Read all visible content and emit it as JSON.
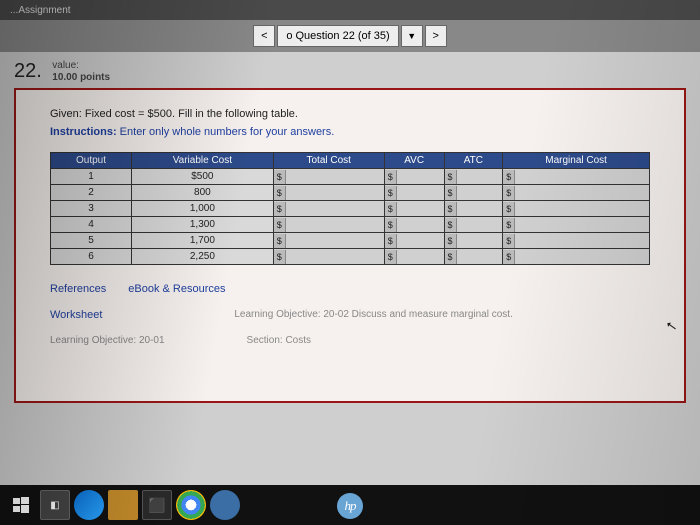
{
  "browser": {
    "title": "...Assignment"
  },
  "nav": {
    "prev": "<",
    "label": "o Question 22 (of 35)",
    "dropdown": "▼",
    "next": ">"
  },
  "question": {
    "number": "22.",
    "value_label": "value:",
    "points": "10.00 points",
    "given": "Given: Fixed cost = $500. Fill in the following table.",
    "instructions_prefix": "Instructions:",
    "instructions_rest": " Enter only whole numbers for your answers."
  },
  "table": {
    "headers": [
      "Output",
      "Variable Cost",
      "Total Cost",
      "AVC",
      "ATC",
      "Marginal Cost"
    ],
    "rows": [
      {
        "output": "1",
        "vc": "$500"
      },
      {
        "output": "2",
        "vc": "800"
      },
      {
        "output": "3",
        "vc": "1,000"
      },
      {
        "output": "4",
        "vc": "1,300"
      },
      {
        "output": "5",
        "vc": "1,700"
      },
      {
        "output": "6",
        "vc": "2,250"
      }
    ],
    "currency": "$"
  },
  "links": {
    "references": "References",
    "ebook": "eBook & Resources",
    "worksheet": "Worksheet",
    "obj_a": "Learning Objective: 20-02 Discuss and measure marginal cost.",
    "obj_b": "Learning Objective: 20-01",
    "obj_b_extra": "Section: Costs"
  },
  "hp": "hp"
}
